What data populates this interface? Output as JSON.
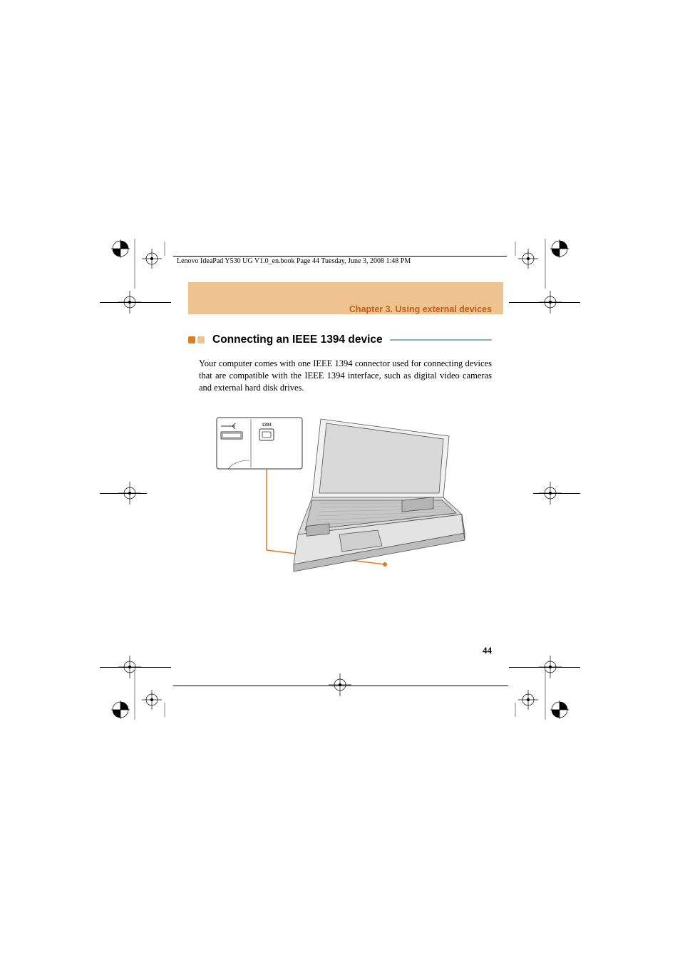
{
  "header_line_text": "Lenovo IdeaPad Y530 UG V1.0_en.book  Page 44  Tuesday, June 3, 2008  1:48 PM",
  "chapter_title": "Chapter 3. Using external devices",
  "section_title": "Connecting an IEEE 1394 device",
  "body_paragraph": "Your computer comes with one IEEE 1394 connector used for connecting devices that are compatible with the IEEE 1394 interface, such as digital video cameras and external hard disk drives.",
  "diagram_label_1394": "1394",
  "page_number": "44"
}
